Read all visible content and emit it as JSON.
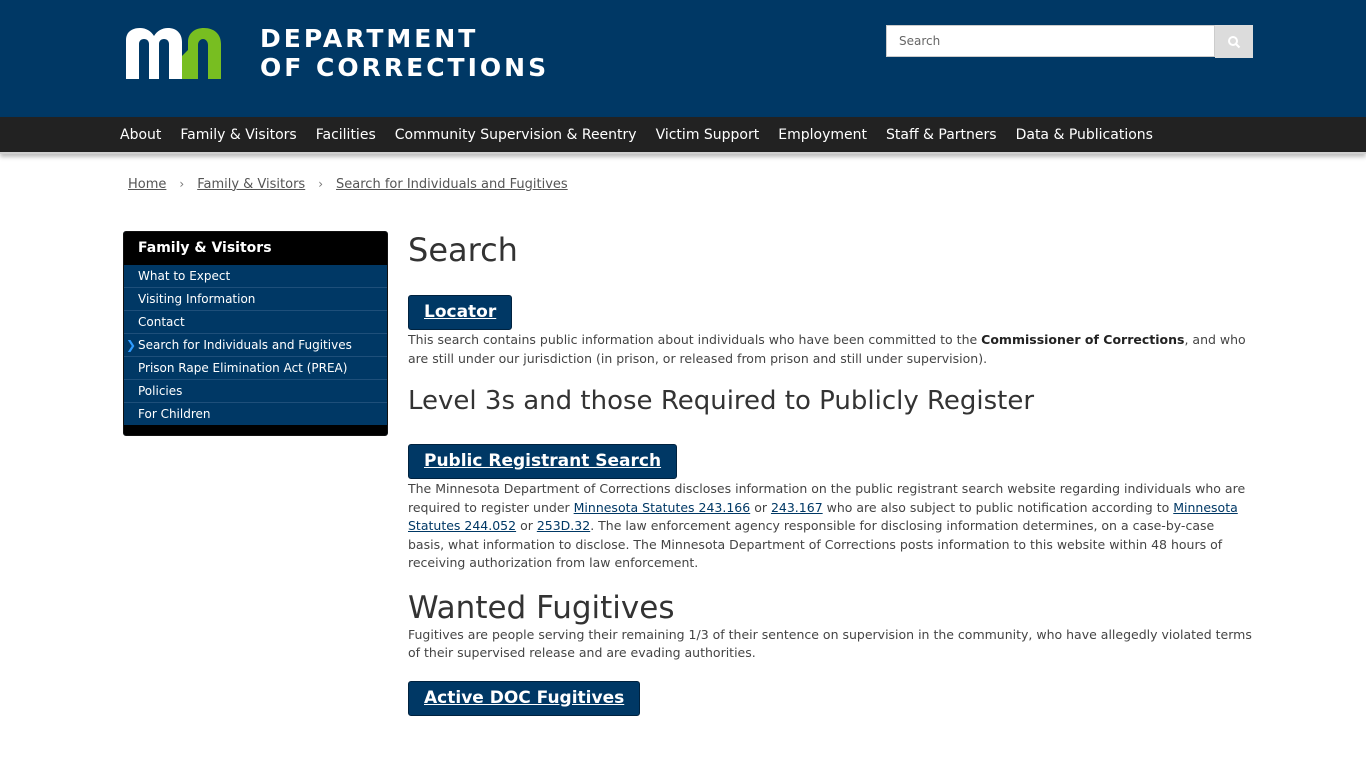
{
  "header": {
    "logo_text_line1": "DEPARTMENT",
    "logo_text_line2": "OF CORRECTIONS",
    "search_placeholder": "Search",
    "colors": {
      "brand_blue": "#003865",
      "logo_green": "#78be21"
    }
  },
  "nav": {
    "items": [
      "About",
      "Family & Visitors",
      "Facilities",
      "Community Supervision & Reentry",
      "Victim Support",
      "Employment",
      "Staff & Partners",
      "Data & Publications"
    ]
  },
  "breadcrumb": {
    "home": "Home",
    "section": "Family & Visitors",
    "current": "Search for Individuals and Fugitives"
  },
  "sidebar": {
    "title": "Family & Visitors",
    "items": [
      "What to Expect",
      "Visiting Information",
      "Contact",
      "Search for Individuals and Fugitives",
      "Prison Rape Elimination Act (PREA)",
      "Policies",
      "For Children"
    ],
    "active_index": 3
  },
  "main": {
    "title": "Search",
    "locator": {
      "button": "Locator",
      "text_1": "This search contains public information about individuals who have been committed to the ",
      "text_bold": "Commissioner of Corrections",
      "text_2": ", and who are still under our jurisdiction (in prison, or released from prison and still under supervision)."
    },
    "level3": {
      "heading": "Level 3s and those Required to Publicly Register",
      "button": "Public Registrant Search",
      "text_1": "The Minnesota Department of Corrections discloses information on the public registrant search website regarding individuals who are required to register under ",
      "link_1": "Minnesota Statutes 243.166",
      "text_2": " or ",
      "link_2": "243.167",
      "text_3": " who are also subject to public notification according to ",
      "link_3": "Minnesota Statutes 244.052",
      "text_4": " or ",
      "link_4": "253D.32",
      "text_5": ". The law enforcement agency responsible for disclosing information determines, on a case-by-case basis, what information to disclose. The Minnesota Department of Corrections posts information to this website within 48 hours of receiving authorization from law enforcement."
    },
    "fugitives": {
      "heading": "Wanted Fugitives",
      "text": "Fugitives are people serving their remaining 1/3 of their sentence on supervision in the community, who have allegedly violated terms of their supervised release and are evading authorities.",
      "button": "Active DOC Fugitives"
    }
  }
}
